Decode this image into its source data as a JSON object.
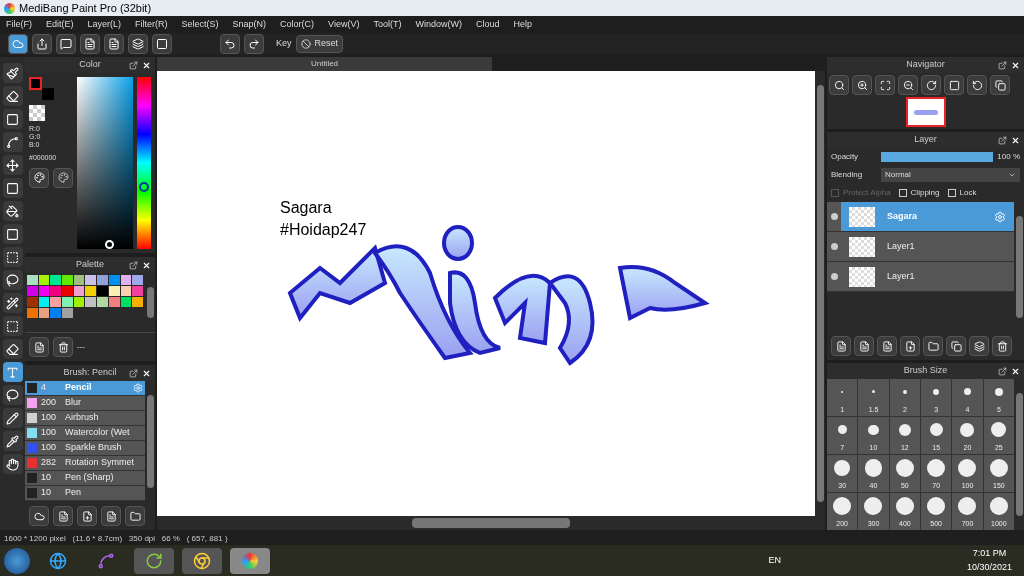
{
  "window": {
    "title": "MediBang Paint Pro (32bit)"
  },
  "menu": [
    "File(F)",
    "Edit(E)",
    "Layer(L)",
    "Filter(R)",
    "Select(S)",
    "Snap(N)",
    "Color(C)",
    "View(V)",
    "Tool(T)",
    "Window(W)",
    "Cloud",
    "Help"
  ],
  "toolbar": {
    "key_label": "Key",
    "reset": "Reset"
  },
  "color_panel": {
    "title": "Color",
    "r": "R:0",
    "g": "G:0",
    "b": "B:0",
    "hex": "#000000",
    "hue": {
      "level": 0.36
    }
  },
  "palette": {
    "title": "Palette",
    "footer": "---",
    "colors": [
      {
        "color": "#a8e0c0"
      },
      {
        "color": "#a8f000"
      },
      {
        "color": "#00e890"
      },
      {
        "color": "#60e800"
      },
      {
        "color": "#a0c080"
      },
      {
        "color": "#c8c0e8"
      },
      {
        "color": "#90a0d8"
      },
      {
        "color": "#0090f0"
      },
      {
        "color": "#e0b0f0"
      },
      {
        "color": "#a0a8e8"
      },
      {
        "color": "#d000e8"
      },
      {
        "color": "#f000f0"
      },
      {
        "color": "#f00080"
      },
      {
        "color": "#e80000"
      },
      {
        "color": "#f0a0d0"
      },
      {
        "color": "#f0d000"
      },
      {
        "color": "#000000"
      },
      {
        "color": "#f8f0b0"
      },
      {
        "color": "#f8d0b0"
      },
      {
        "color": "#f040a0"
      },
      {
        "color": "#a03000"
      },
      {
        "color": "#00f0f0"
      },
      {
        "color": "#f8a0a0"
      },
      {
        "color": "#80f0b0"
      },
      {
        "color": "#a0f000"
      },
      {
        "color": "#c0c0c0"
      },
      {
        "color": "#b0d8a0"
      },
      {
        "color": "#f08080"
      },
      {
        "color": "#00e060"
      },
      {
        "color": "#f8b000"
      },
      {
        "color": "#f07000"
      },
      {
        "color": "#e8a080"
      },
      {
        "color": "#0080f0"
      },
      {
        "color": "#a0a0a0"
      }
    ]
  },
  "brush_panel": {
    "title": "Brush: Pencil",
    "brushes": [
      {
        "size": "4",
        "name": "Pencil",
        "color": "#222222",
        "selected": true
      },
      {
        "size": "200",
        "name": "Blur",
        "color": "#f8a0f0",
        "selected": false
      },
      {
        "size": "100",
        "name": "Airbrush",
        "color": "#d0d0d0",
        "selected": false
      },
      {
        "size": "100",
        "name": "Watercolor (Wet",
        "color": "#80e0f0",
        "selected": false
      },
      {
        "size": "100",
        "name": "Sparkle Brush",
        "color": "#3050f0",
        "selected": false
      },
      {
        "size": "282",
        "name": "Rotation Symmet",
        "color": "#e83030",
        "selected": false
      },
      {
        "size": "10",
        "name": "Pen (Sharp)",
        "color": "#222222",
        "selected": false
      },
      {
        "size": "10",
        "name": "Pen",
        "color": "#222222",
        "selected": false
      }
    ]
  },
  "canvas": {
    "tab": "Untitled",
    "texts": [
      "Sagara",
      "#Hoidap247"
    ]
  },
  "navigator": {
    "title": "Navigator"
  },
  "layer_panel": {
    "title": "Layer",
    "opacity_label": "Opacity",
    "opacity": {
      "level": 1.0,
      "reading": "100 %"
    },
    "blending_label": "Blending",
    "blending": "Normal",
    "options": [
      {
        "label": "Protect Alpha",
        "checked": false,
        "disabled": true
      },
      {
        "label": "Clipping",
        "checked": false,
        "disabled": false
      },
      {
        "label": "Lock",
        "checked": false,
        "disabled": false
      }
    ],
    "layers": [
      {
        "name": "Sagara",
        "selected": true
      },
      {
        "name": "Layer1",
        "selected": false
      },
      {
        "name": "Layer1",
        "selected": false
      }
    ]
  },
  "brush_size": {
    "title": "Brush Size",
    "sizes": [
      "1",
      "1.5",
      "2",
      "3",
      "4",
      "5",
      "7",
      "10",
      "12",
      "15",
      "20",
      "25",
      "30",
      "40",
      "50",
      "70",
      "100",
      "150",
      "200",
      "300",
      "400",
      "500",
      "700",
      "1000"
    ]
  },
  "status_bar": "1600 * 1200 pixel   (11.6 * 8.7cm)   350 dpi   66 %   ( 657, 881 )",
  "taskbar": {
    "language": "EN",
    "time": "7:01 PM",
    "date": "10/30/2021"
  }
}
